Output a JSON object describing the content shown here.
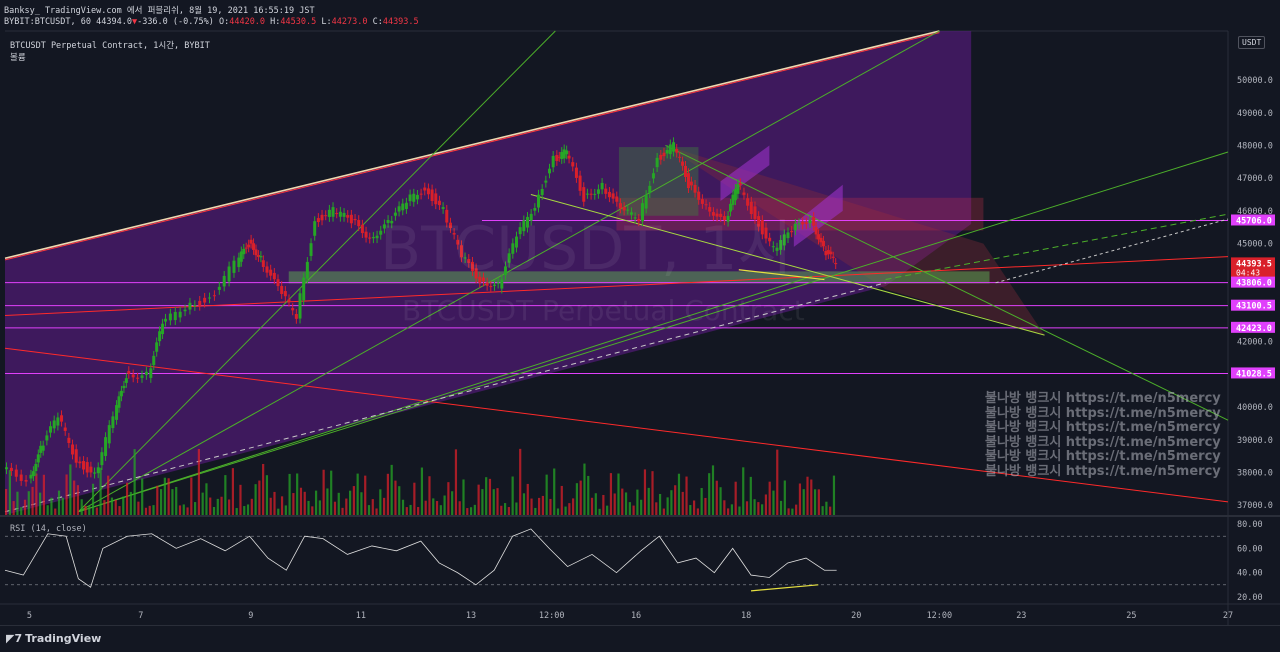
{
  "header": {
    "line1": "Banksy_ TradingView.com 에서 퍼블리쉬, 8월 19, 2021 16:55:19 JST",
    "symbol": "BYBIT:BTCUSDT, 60",
    "last": "44394.0",
    "change_arrow": "▼",
    "change": "-336.0 (-0.75%)",
    "o_label": "O:",
    "o": "44420.0",
    "h_label": "H:",
    "h": "44530.5",
    "l_label": "L:",
    "l": "44273.0",
    "c_label": "C:",
    "c": "44393.5"
  },
  "legend": {
    "title": "BTCUSDT Perpetual Contract, 1시간, BYBIT",
    "sub": "볼륨"
  },
  "currency_button": "USDT",
  "watermark": {
    "big": "BTCUSDT, 1시",
    "sub": "BTCUSDT Perpetual Contract",
    "lines": [
      "불나방 뱅크시 https://t.me/n5mercy",
      "불나방 뱅크시 https://t.me/n5mercy",
      "불나방 뱅크시 https://t.me/n5mercy",
      "불나방 뱅크시 https://t.me/n5mercy",
      "불나방 뱅크시 https://t.me/n5mercy",
      "불나방 뱅크시 https://t.me/n5mercy"
    ]
  },
  "rsi_label": "RSI (14, close)",
  "footer_brand": "TradingView",
  "colors": {
    "background": "#131722",
    "purple_zone": "#5b1a86",
    "magenta_line": "#e040fb",
    "red_line": "#ff2a2a",
    "green_line": "#4caf2a",
    "up": "#26a626",
    "down": "#d9202a"
  },
  "chart_data": {
    "type": "candlestick",
    "y_axis": {
      "range": [
        36700,
        51500
      ],
      "ticks": [
        "50000.0",
        "49000.0",
        "48000.0",
        "47000.0",
        "46000.0",
        "45000.0",
        "42000.0",
        "40000.0",
        "39000.0",
        "38000.0",
        "37000.0"
      ]
    },
    "x_axis": {
      "ticks": [
        "5",
        "7",
        "9",
        "11",
        "13",
        "12:00",
        "16",
        "18",
        "20",
        "12:00",
        "23",
        "25",
        "27"
      ],
      "tick_positions": [
        0.02,
        0.111,
        0.201,
        0.291,
        0.381,
        0.447,
        0.516,
        0.606,
        0.696,
        0.764,
        0.831,
        0.921,
        1.0
      ]
    },
    "price_labels": [
      {
        "text": "44393.5",
        "sub": "04:43",
        "value": 44393.5,
        "color": "#d9202a"
      },
      {
        "text": "45706.0",
        "value": 45706,
        "color": "#e040fb"
      },
      {
        "text": "43806.0",
        "value": 43806,
        "color": "#e040fb"
      },
      {
        "text": "43100.5",
        "value": 43100.5,
        "color": "#e040fb"
      },
      {
        "text": "42423.0",
        "value": 42423,
        "color": "#e040fb"
      },
      {
        "text": "41028.5",
        "value": 41028.5,
        "color": "#e040fb"
      }
    ],
    "horizontal_levels": [
      45706,
      43806,
      43100.5,
      42423,
      41028.5
    ],
    "price_path": [
      [
        0.0,
        38100
      ],
      [
        0.02,
        37800
      ],
      [
        0.03,
        38700
      ],
      [
        0.045,
        39700
      ],
      [
        0.06,
        38400
      ],
      [
        0.075,
        37900
      ],
      [
        0.09,
        39700
      ],
      [
        0.1,
        41000
      ],
      [
        0.118,
        41000
      ],
      [
        0.13,
        42500
      ],
      [
        0.15,
        43100
      ],
      [
        0.17,
        43300
      ],
      [
        0.19,
        44400
      ],
      [
        0.2,
        45000
      ],
      [
        0.21,
        44600
      ],
      [
        0.225,
        43600
      ],
      [
        0.24,
        42800
      ],
      [
        0.255,
        45700
      ],
      [
        0.27,
        46000
      ],
      [
        0.285,
        45700
      ],
      [
        0.3,
        45200
      ],
      [
        0.315,
        45600
      ],
      [
        0.33,
        46300
      ],
      [
        0.345,
        46700
      ],
      [
        0.36,
        46000
      ],
      [
        0.375,
        44600
      ],
      [
        0.39,
        43900
      ],
      [
        0.405,
        43700
      ],
      [
        0.42,
        45200
      ],
      [
        0.435,
        46200
      ],
      [
        0.45,
        47600
      ],
      [
        0.46,
        47800
      ],
      [
        0.475,
        46400
      ],
      [
        0.49,
        46800
      ],
      [
        0.505,
        46000
      ],
      [
        0.52,
        45800
      ],
      [
        0.535,
        47600
      ],
      [
        0.548,
        48000
      ],
      [
        0.56,
        46800
      ],
      [
        0.575,
        46200
      ],
      [
        0.59,
        45600
      ],
      [
        0.6,
        46900
      ],
      [
        0.615,
        45800
      ],
      [
        0.63,
        44800
      ],
      [
        0.645,
        45400
      ],
      [
        0.66,
        45800
      ],
      [
        0.67,
        44800
      ],
      [
        0.68,
        44393.5
      ]
    ],
    "rsi_axis": {
      "ticks": [
        "80.00",
        "60.00",
        "40.00",
        "20.00"
      ],
      "range": [
        15,
        85
      ],
      "bands": [
        70,
        30
      ]
    },
    "rsi_path": [
      [
        0.0,
        42
      ],
      [
        0.015,
        38
      ],
      [
        0.025,
        55
      ],
      [
        0.035,
        72
      ],
      [
        0.05,
        70
      ],
      [
        0.06,
        35
      ],
      [
        0.07,
        28
      ],
      [
        0.08,
        60
      ],
      [
        0.1,
        70
      ],
      [
        0.12,
        72
      ],
      [
        0.14,
        60
      ],
      [
        0.16,
        68
      ],
      [
        0.18,
        58
      ],
      [
        0.2,
        70
      ],
      [
        0.215,
        52
      ],
      [
        0.23,
        42
      ],
      [
        0.245,
        70
      ],
      [
        0.26,
        68
      ],
      [
        0.28,
        55
      ],
      [
        0.3,
        62
      ],
      [
        0.32,
        58
      ],
      [
        0.34,
        66
      ],
      [
        0.355,
        48
      ],
      [
        0.37,
        40
      ],
      [
        0.385,
        30
      ],
      [
        0.4,
        42
      ],
      [
        0.415,
        70
      ],
      [
        0.43,
        76
      ],
      [
        0.445,
        60
      ],
      [
        0.46,
        45
      ],
      [
        0.48,
        55
      ],
      [
        0.5,
        40
      ],
      [
        0.52,
        58
      ],
      [
        0.535,
        70
      ],
      [
        0.55,
        48
      ],
      [
        0.565,
        52
      ],
      [
        0.58,
        40
      ],
      [
        0.595,
        60
      ],
      [
        0.61,
        38
      ],
      [
        0.625,
        36
      ],
      [
        0.64,
        48
      ],
      [
        0.655,
        52
      ],
      [
        0.67,
        42
      ],
      [
        0.68,
        42
      ]
    ]
  }
}
